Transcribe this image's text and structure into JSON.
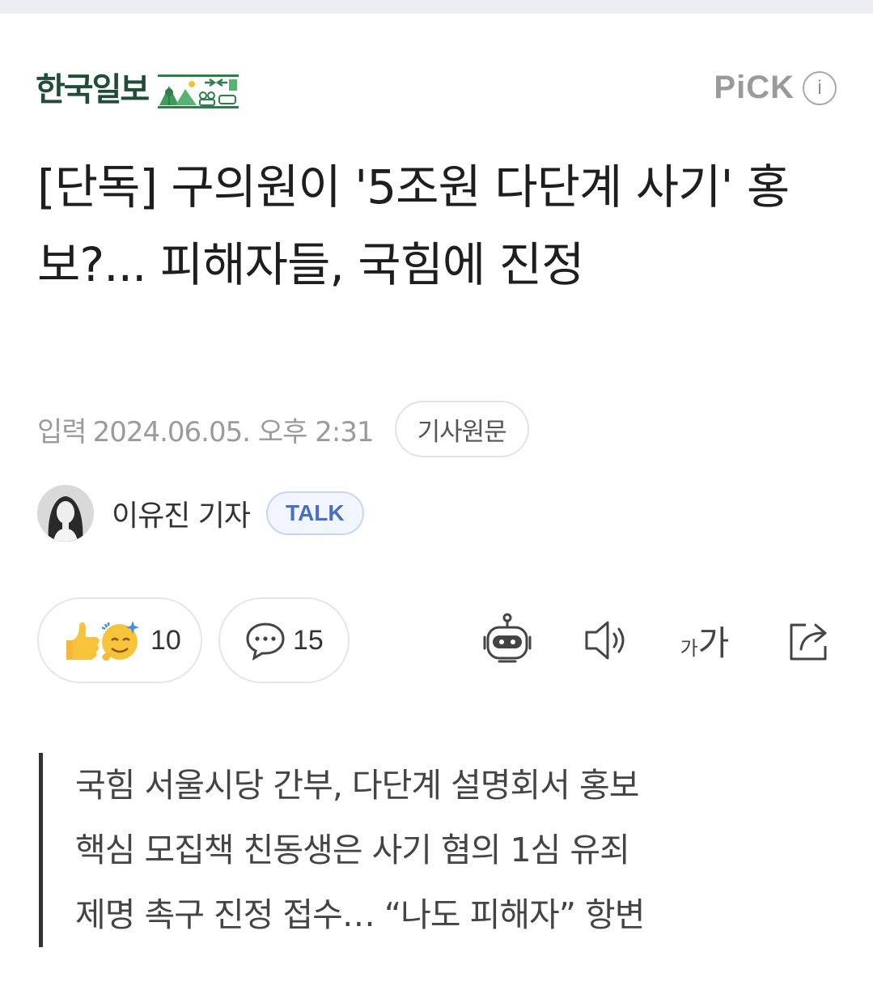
{
  "header": {
    "press_name": "한국일보",
    "pick_label": "PiCK",
    "info_label": "i"
  },
  "article": {
    "headline": "[단독] 구의원이 '5조원 다단계 사기' 홍보?... 피해자들, 국힘에 진정",
    "meta_label": "입력",
    "date": "2024.06.05. 오후 2:31",
    "original_button": "기사원문",
    "reporter": "이유진 기자",
    "talk_label": "TALK"
  },
  "actions": {
    "reaction_count": "10",
    "comment_count": "15",
    "font_small": "가",
    "font_big": "가"
  },
  "summary": {
    "lines": [
      "국힘 서울시당 간부, 다단계 설명회서 홍보",
      "핵심 모집책 친동생은 사기 혐의 1심 유죄",
      "제명 촉구 진정 접수… “나도 피해자” 항변"
    ]
  },
  "colors": {
    "press_green": "#1f4d35",
    "talk_blue": "#4a6fc0",
    "text_main": "#1e1e1e",
    "text_muted": "#9b9b9b",
    "reaction_yellow": "#f6c33b"
  }
}
